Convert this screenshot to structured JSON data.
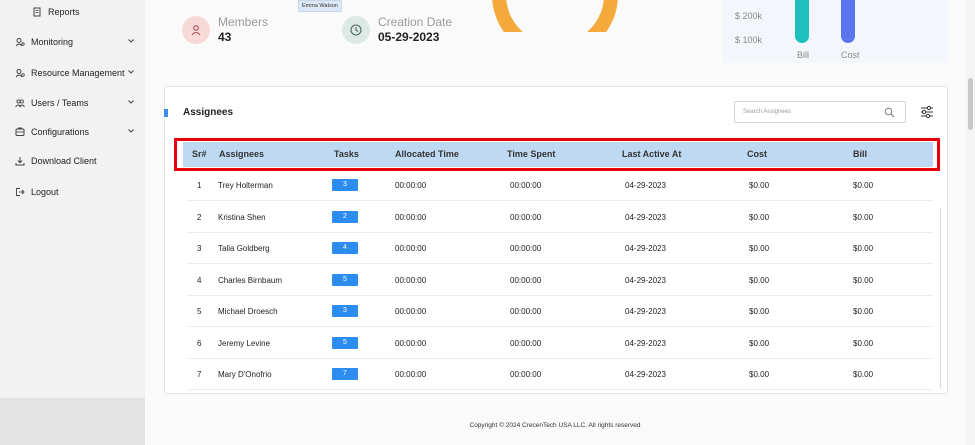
{
  "sidebar": {
    "items": [
      {
        "label": "Reports",
        "icon": "report-icon",
        "sub": true
      },
      {
        "label": "Monitoring",
        "icon": "monitoring-icon",
        "chevron": true
      },
      {
        "label": "Resource Management",
        "icon": "resource-icon",
        "chevron": true
      },
      {
        "label": "Users / Teams",
        "icon": "users-icon",
        "chevron": true
      },
      {
        "label": "Configurations",
        "icon": "configurations-icon",
        "chevron": true
      },
      {
        "label": "Download Client",
        "icon": "download-icon"
      },
      {
        "label": "Logout",
        "icon": "logout-icon"
      }
    ]
  },
  "stats": {
    "members": {
      "label": "Members",
      "value": "43",
      "icon": "members-icon",
      "color": "#f7d9d8"
    },
    "creation": {
      "label": "Creation Date",
      "value": "05-29-2023",
      "icon": "clock-icon",
      "color": "#dde9e4"
    },
    "tooltip": "Emma Watson"
  },
  "chart_data": {
    "type": "bar",
    "categories": [
      "Bill",
      "Cost"
    ],
    "yticks": [
      "$ 200k",
      "$ 100k"
    ],
    "series_colors": [
      "#1fbfbf",
      "#5b74f0"
    ]
  },
  "assignees": {
    "title": "Assignees",
    "search_placeholder": "Search Assignees",
    "columns": [
      "Sr#",
      "Assignees",
      "Tasks",
      "Allocated Time",
      "Time Spent",
      "Last Active At",
      "Cost",
      "Bill"
    ],
    "rows": [
      {
        "sr": "1",
        "name": "Trey Holterman",
        "tasks": "3",
        "allocated": "00:00:00",
        "spent": "00:00:00",
        "last": "04-29-2023",
        "cost": "$0.00",
        "bill": "$0.00"
      },
      {
        "sr": "2",
        "name": "Kristina Shen",
        "tasks": "2",
        "allocated": "00:00:00",
        "spent": "00:00:00",
        "last": "04-29-2023",
        "cost": "$0.00",
        "bill": "$0.00"
      },
      {
        "sr": "3",
        "name": "Talia Goldberg",
        "tasks": "4",
        "allocated": "00:00:00",
        "spent": "00:00:00",
        "last": "04-29-2023",
        "cost": "$0.00",
        "bill": "$0.00"
      },
      {
        "sr": "4",
        "name": "Charles Birnbaum",
        "tasks": "5",
        "allocated": "00:00:00",
        "spent": "00:00:00",
        "last": "04-29-2023",
        "cost": "$0.00",
        "bill": "$0.00"
      },
      {
        "sr": "5",
        "name": "Michael Droesch",
        "tasks": "3",
        "allocated": "00:00:00",
        "spent": "00:00:00",
        "last": "04-29-2023",
        "cost": "$0.00",
        "bill": "$0.00"
      },
      {
        "sr": "6",
        "name": "Jeremy Levine",
        "tasks": "5",
        "allocated": "00:00:00",
        "spent": "00:00:00",
        "last": "04-29-2023",
        "cost": "$0.00",
        "bill": "$0.00"
      },
      {
        "sr": "7",
        "name": "Mary D'Onofrio",
        "tasks": "7",
        "allocated": "00:00:00",
        "spent": "00:00:00",
        "last": "04-29-2023",
        "cost": "$0.00",
        "bill": "$0.00"
      }
    ]
  },
  "footer": "Copyright © 2024 CrecenTech USA LLC. All rights reserved",
  "colors": {
    "accent": "#2d8cf0",
    "header_bg": "#bfd9f3",
    "highlight": "#e8000b",
    "donut": "#f5a93b"
  }
}
